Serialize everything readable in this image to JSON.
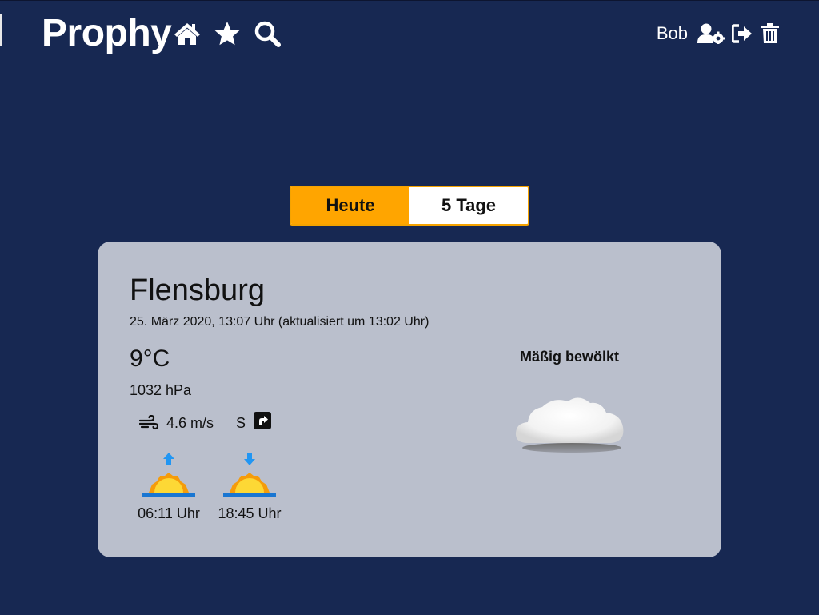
{
  "app": {
    "title": "Prophy"
  },
  "header": {
    "nav_icons": [
      "home-icon",
      "star-icon",
      "search-icon"
    ],
    "user": {
      "name": "Bob",
      "icons": [
        "user-settings-icon",
        "logout-icon",
        "trash-icon"
      ]
    }
  },
  "tabs": [
    {
      "label": "Heute",
      "active": true
    },
    {
      "label": "5 Tage",
      "active": false
    }
  ],
  "weather": {
    "city": "Flensburg",
    "timestamp": "25. März 2020, 13:07 Uhr (aktualisiert um 13:02 Uhr)",
    "temperature": "9°C",
    "pressure": "1032 hPa",
    "wind_speed": "4.6 m/s",
    "wind_direction": "S",
    "sunrise": "06:11 Uhr",
    "sunset": "18:45 Uhr",
    "condition": "Mäßig bewölkt"
  },
  "colors": {
    "background": "#172852",
    "accent": "#ffa500",
    "card": "#babfcc"
  }
}
